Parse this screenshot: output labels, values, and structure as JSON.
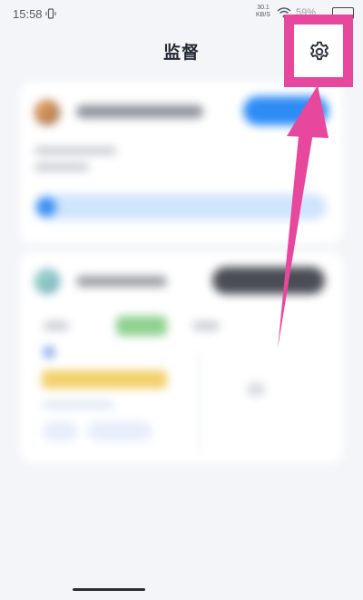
{
  "status_bar": {
    "time": "15:58",
    "net_speed_value": "30.1",
    "net_speed_unit": "KB/S",
    "battery_text": "59%"
  },
  "header": {
    "title": "监督",
    "settings_icon": "gear-icon"
  },
  "annotation": {
    "highlight_color": "#e8479e",
    "arrow_color": "#e8479e"
  },
  "colors": {
    "accent_blue": "#2e8cf5",
    "background": "#f4f5f8"
  }
}
